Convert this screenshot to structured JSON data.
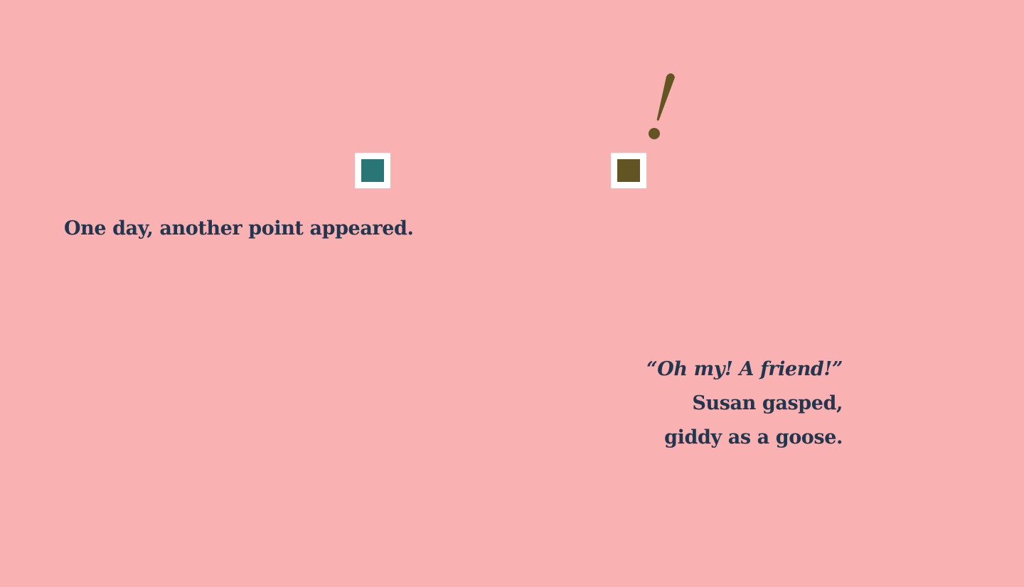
{
  "scene": {
    "background_color": "#F9B1B1",
    "text_color": "#22364F"
  },
  "points": [
    {
      "name": "first point",
      "color": "#2A7575"
    },
    {
      "name": "new point",
      "color": "#635424"
    }
  ],
  "exclamation": {
    "glyph": "!",
    "color": "#635424"
  },
  "narration": "One day, another point appeared.",
  "dialogue": {
    "quote": "“Oh my! A friend!”",
    "line2": "Susan gasped,",
    "line3": "giddy as a goose."
  }
}
